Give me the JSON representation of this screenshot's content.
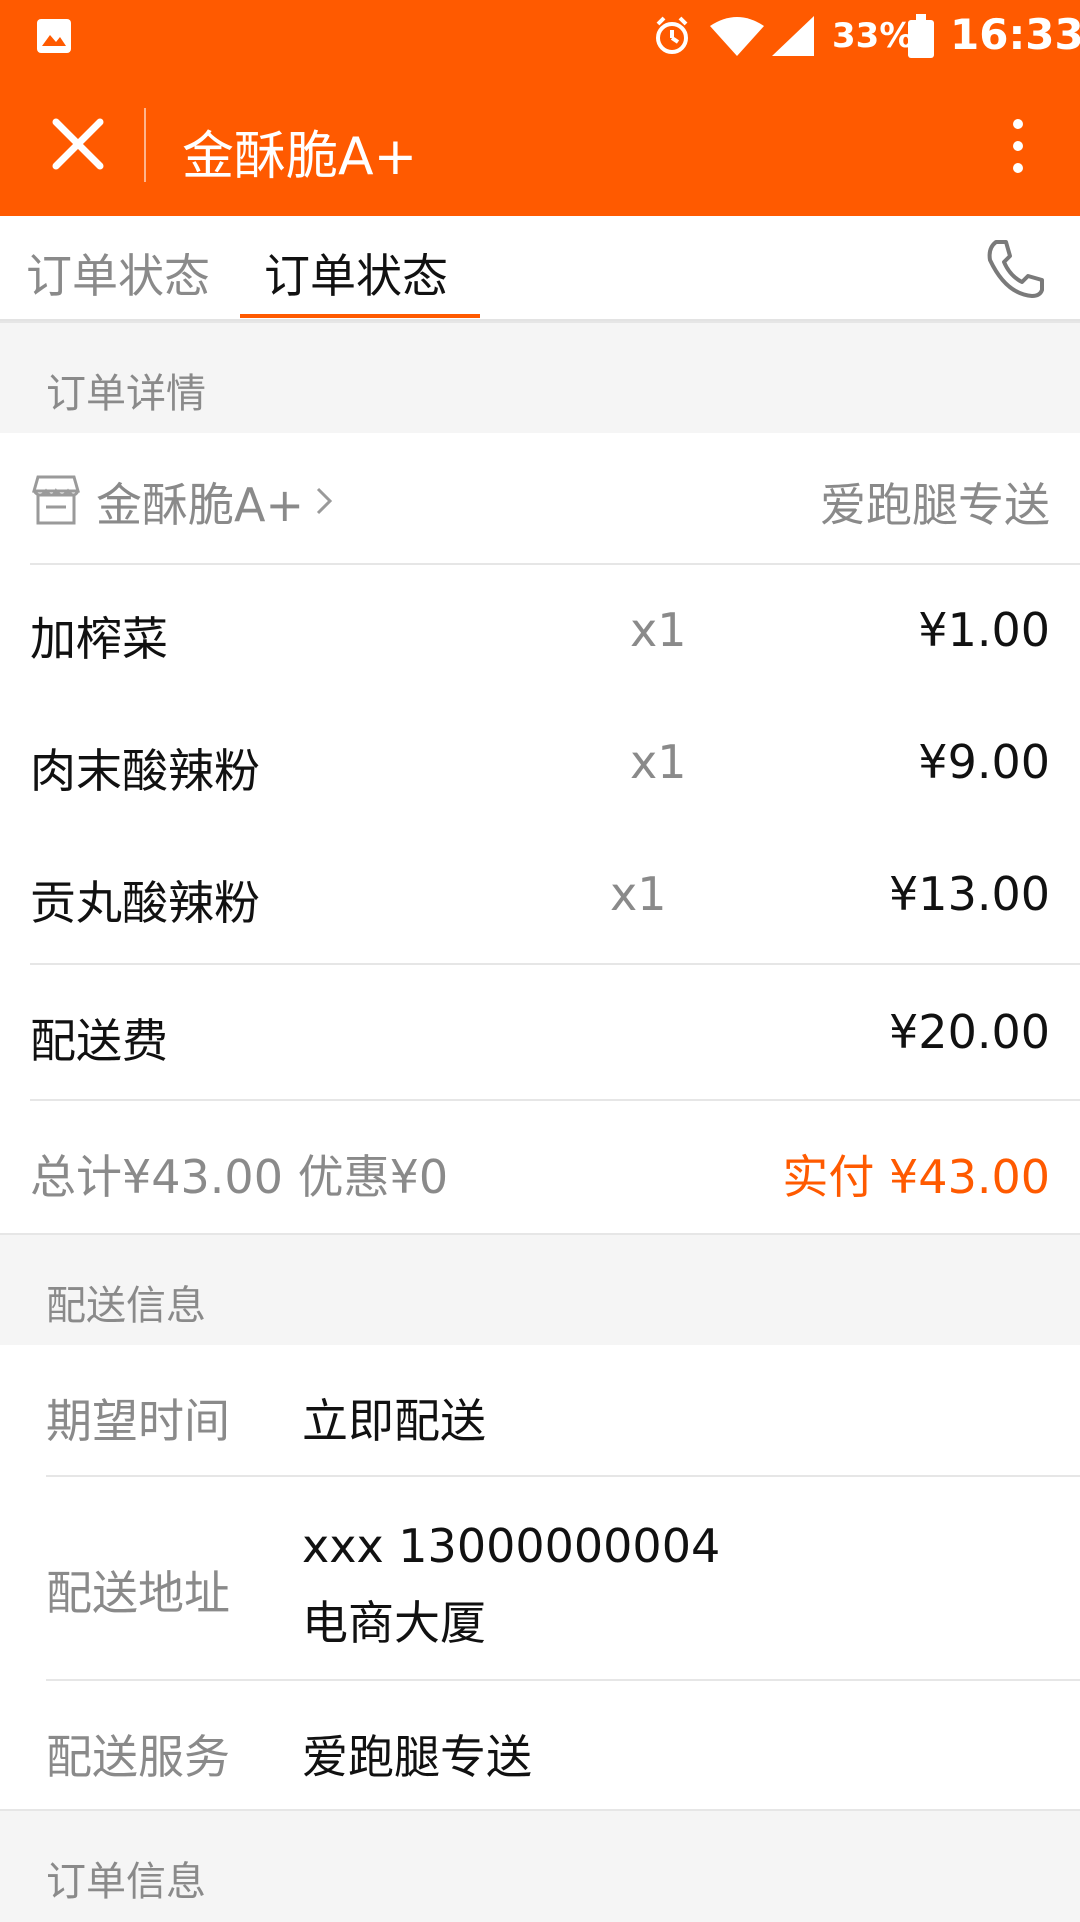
{
  "status_bar": {
    "battery": "33%",
    "time": "16:33",
    "icons": [
      "image-icon",
      "alarm-icon",
      "wifi-icon",
      "signal-icon",
      "battery-icon"
    ]
  },
  "app_bar": {
    "title": "金酥脆A+",
    "icons": [
      "close-icon",
      "more-vertical-icon"
    ]
  },
  "tabs": {
    "items": [
      {
        "label": "订单状态"
      },
      {
        "label": "订单状态"
      }
    ],
    "phone_icon": "phone-icon"
  },
  "sections": {
    "order_details": "订单详情",
    "delivery_info": "配送信息",
    "order_info": "订单信息"
  },
  "store": {
    "name": "金酥脆A+",
    "service": "爱跑腿专送",
    "icons": [
      "store-icon",
      "chevron-right-icon"
    ]
  },
  "items": [
    {
      "name": "加榨菜",
      "qty": "x1",
      "price": "¥1.00"
    },
    {
      "name": "肉末酸辣粉",
      "qty": "x1",
      "price": "¥9.00"
    },
    {
      "name": "贡丸酸辣粉",
      "qty": "x1",
      "price": "¥13.00"
    }
  ],
  "delivery_fee": {
    "label": "配送费",
    "amount": "¥20.00"
  },
  "summary": {
    "total_and_discount": "总计¥43.00 优惠¥0",
    "paid": "实付 ¥43.00"
  },
  "delivery": {
    "expected_time_label": "期望时间",
    "expected_time_value": "立即配送",
    "address_label": "配送地址",
    "address_line1": "xxx 13000000004",
    "address_line2": "电商大厦",
    "service_label": "配送服务",
    "service_value": "爱跑腿专送"
  },
  "colors": {
    "accent": "#ff5a00",
    "page_bg": "#f5f5f5",
    "divider": "#e6e6e6"
  }
}
